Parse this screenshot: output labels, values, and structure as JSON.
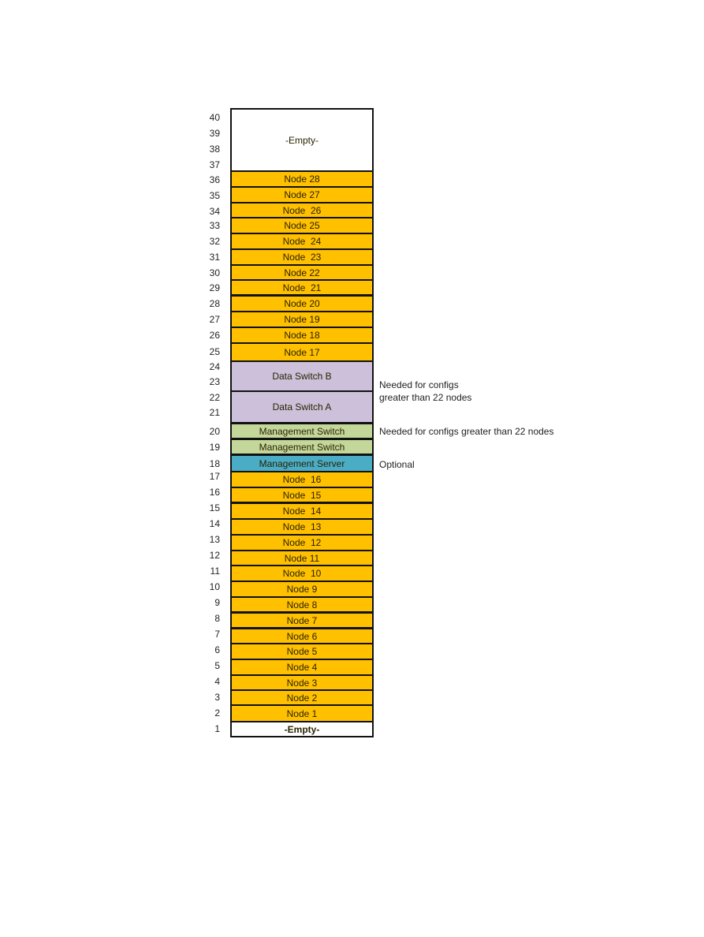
{
  "colors": {
    "node": "#FFC000",
    "data_switch": "#CCC0DA",
    "management_switch": "#C4D79B",
    "management_server": "#4BACC6",
    "empty": "#FFFFFF"
  },
  "units": [
    "40",
    "39",
    "38",
    "37",
    "36",
    "35",
    "34",
    "33",
    "32",
    "31",
    "30",
    "29",
    "28",
    "27",
    "26",
    "25",
    "24",
    "23",
    "22",
    "21",
    "20",
    "19",
    "18",
    "17",
    "16",
    "15",
    "14",
    "13",
    "12",
    "11",
    "10",
    "9",
    "8",
    "7",
    "6",
    "5",
    "4",
    "3",
    "2",
    "1"
  ],
  "slots": [
    {
      "label": "-Empty-",
      "type": "empty",
      "units": "37-40"
    },
    {
      "label": "Node 28",
      "type": "node",
      "units": "36"
    },
    {
      "label": "Node 27",
      "type": "node",
      "units": "35"
    },
    {
      "label": "Node  26",
      "type": "node",
      "units": "34"
    },
    {
      "label": "Node 25",
      "type": "node",
      "units": "33"
    },
    {
      "label": "Node  24",
      "type": "node",
      "units": "32"
    },
    {
      "label": "Node  23",
      "type": "node",
      "units": "31"
    },
    {
      "label": "Node 22",
      "type": "node",
      "units": "30"
    },
    {
      "label": "Node  21",
      "type": "node",
      "units": "29"
    },
    {
      "label": "Node 20",
      "type": "node",
      "units": "28"
    },
    {
      "label": "Node 19",
      "type": "node",
      "units": "27"
    },
    {
      "label": "Node 18",
      "type": "node",
      "units": "26"
    },
    {
      "label": "Node 17",
      "type": "node",
      "units": "25"
    },
    {
      "label": "Data Switch B",
      "type": "data_switch",
      "units": "23-24"
    },
    {
      "label": "Data Switch A",
      "type": "data_switch",
      "units": "21-22"
    },
    {
      "label": "Management Switch",
      "type": "management_switch",
      "units": "20"
    },
    {
      "label": "Management Switch",
      "type": "management_switch",
      "units": "19"
    },
    {
      "label": "Management Server",
      "type": "management_server",
      "units": "18"
    },
    {
      "label": "Node  16",
      "type": "node",
      "units": "17"
    },
    {
      "label": "Node  15",
      "type": "node",
      "units": "16"
    },
    {
      "label": "Node  14",
      "type": "node",
      "units": "15"
    },
    {
      "label": "Node  13",
      "type": "node",
      "units": "14"
    },
    {
      "label": "Node  12",
      "type": "node",
      "units": "13"
    },
    {
      "label": "Node 11",
      "type": "node",
      "units": "12"
    },
    {
      "label": "Node  10",
      "type": "node",
      "units": "11"
    },
    {
      "label": "Node 9",
      "type": "node",
      "units": "10"
    },
    {
      "label": "Node 8",
      "type": "node",
      "units": "9"
    },
    {
      "label": "Node 7",
      "type": "node",
      "units": "8"
    },
    {
      "label": "Node 6",
      "type": "node",
      "units": "7"
    },
    {
      "label": "Node 5",
      "type": "node",
      "units": "6"
    },
    {
      "label": "Node 4",
      "type": "node",
      "units": "5"
    },
    {
      "label": "Node 3",
      "type": "node",
      "units": "4"
    },
    {
      "label": "Node 2",
      "type": "node",
      "units": "3"
    },
    {
      "label": "Node 1",
      "type": "node",
      "units": "2"
    },
    {
      "label": "-Empty-",
      "type": "empty",
      "units": "1"
    }
  ],
  "notes": {
    "data_switches": "Needed for configs\ngreater than 22 nodes",
    "management_switch": "Needed for configs greater than 22 nodes",
    "management_server": "Optional"
  }
}
